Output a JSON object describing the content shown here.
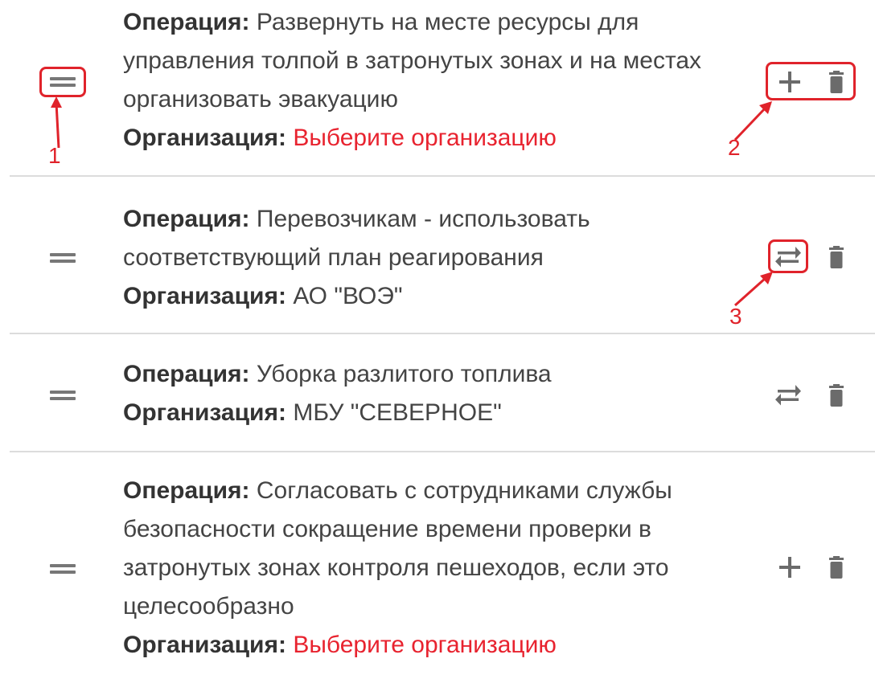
{
  "labels": {
    "operation": "Операция:",
    "organization": "Организация:"
  },
  "rows": [
    {
      "operation_lines": [
        "Развернуть на месте ресурсы для",
        "управления толпой в затронутых зонах и на местах",
        "организовать эвакуацию"
      ],
      "organization": "Выберите организацию",
      "organization_missing": true,
      "action": "add-icon"
    },
    {
      "operation_lines": [
        "Перевозчикам - использовать",
        "соответствующий план реагирования"
      ],
      "organization": "АО \"ВОЭ\"",
      "organization_missing": false,
      "action": "swap-icon"
    },
    {
      "operation_lines": [
        "Уборка разлитого топлива"
      ],
      "organization": "МБУ \"СЕВЕРНОЕ\"",
      "organization_missing": false,
      "action": "swap-icon"
    },
    {
      "operation_lines": [
        "Согласовать с сотрудниками службы",
        "безопасности сокращение времени проверки в",
        "затронутых зонах контроля пешеходов, если это",
        "целесообразно"
      ],
      "organization": "Выберите организацию",
      "organization_missing": true,
      "action": "add-icon"
    }
  ],
  "annotations": [
    "1",
    "2",
    "3"
  ],
  "colors": {
    "annotation": "#e0232b",
    "warning_text": "#e8232f",
    "icon": "#6b6b6b",
    "divider": "#dcdcdc"
  }
}
